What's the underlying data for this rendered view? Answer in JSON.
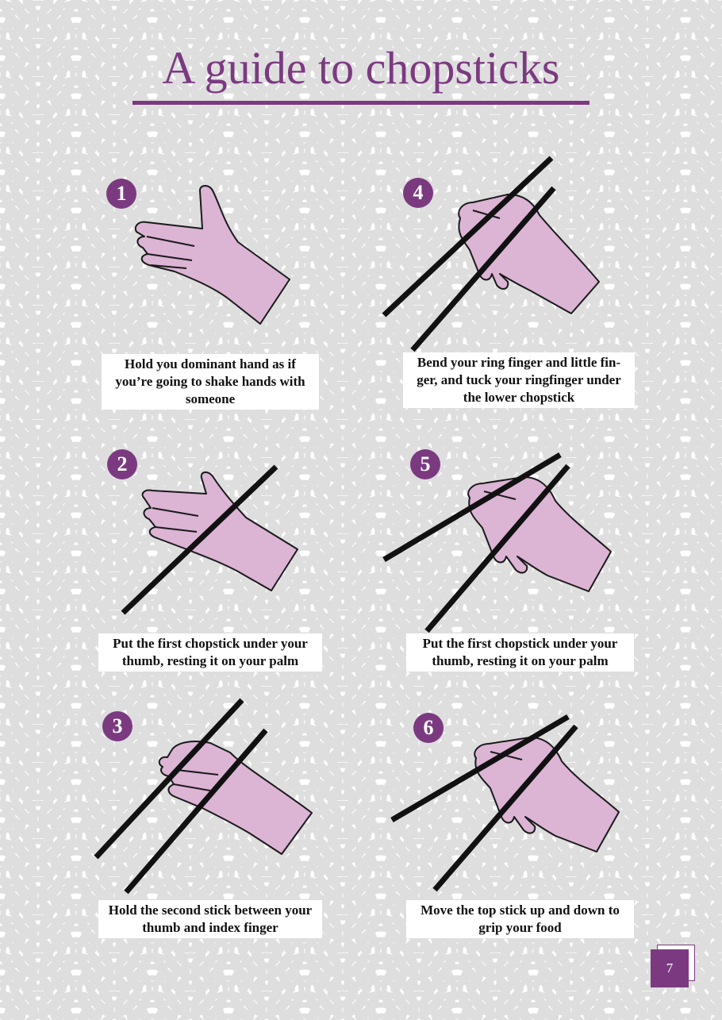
{
  "page": {
    "title": "A guide to chopsticks",
    "page_number": "7",
    "accent_color": "#7b3a80",
    "hand_color": "#dcb4d4",
    "background_pattern": "seigaiha-waves"
  },
  "steps": [
    {
      "number": "1",
      "caption": "Hold you dominant hand as if you’re going to shake hands with someone",
      "icon": "open-hand-icon"
    },
    {
      "number": "2",
      "caption": "Put the first chopstick under your thumb, resting it on your palm",
      "icon": "hand-one-chopstick-icon"
    },
    {
      "number": "3",
      "caption": "Hold the second stick between your thumb and index finger",
      "icon": "hand-two-chopsticks-icon"
    },
    {
      "number": "4",
      "caption": "Bend your ring finger and little fin-ger, and tuck your ringfinger under the lower chopstick",
      "icon": "hand-tuck-ring-finger-icon"
    },
    {
      "number": "5",
      "caption": "Put the first chopstick under your thumb, resting it on your palm",
      "icon": "hand-grip-chopsticks-icon"
    },
    {
      "number": "6",
      "caption": "Move the top stick up and down to grip your food",
      "icon": "hand-move-top-stick-icon"
    }
  ]
}
